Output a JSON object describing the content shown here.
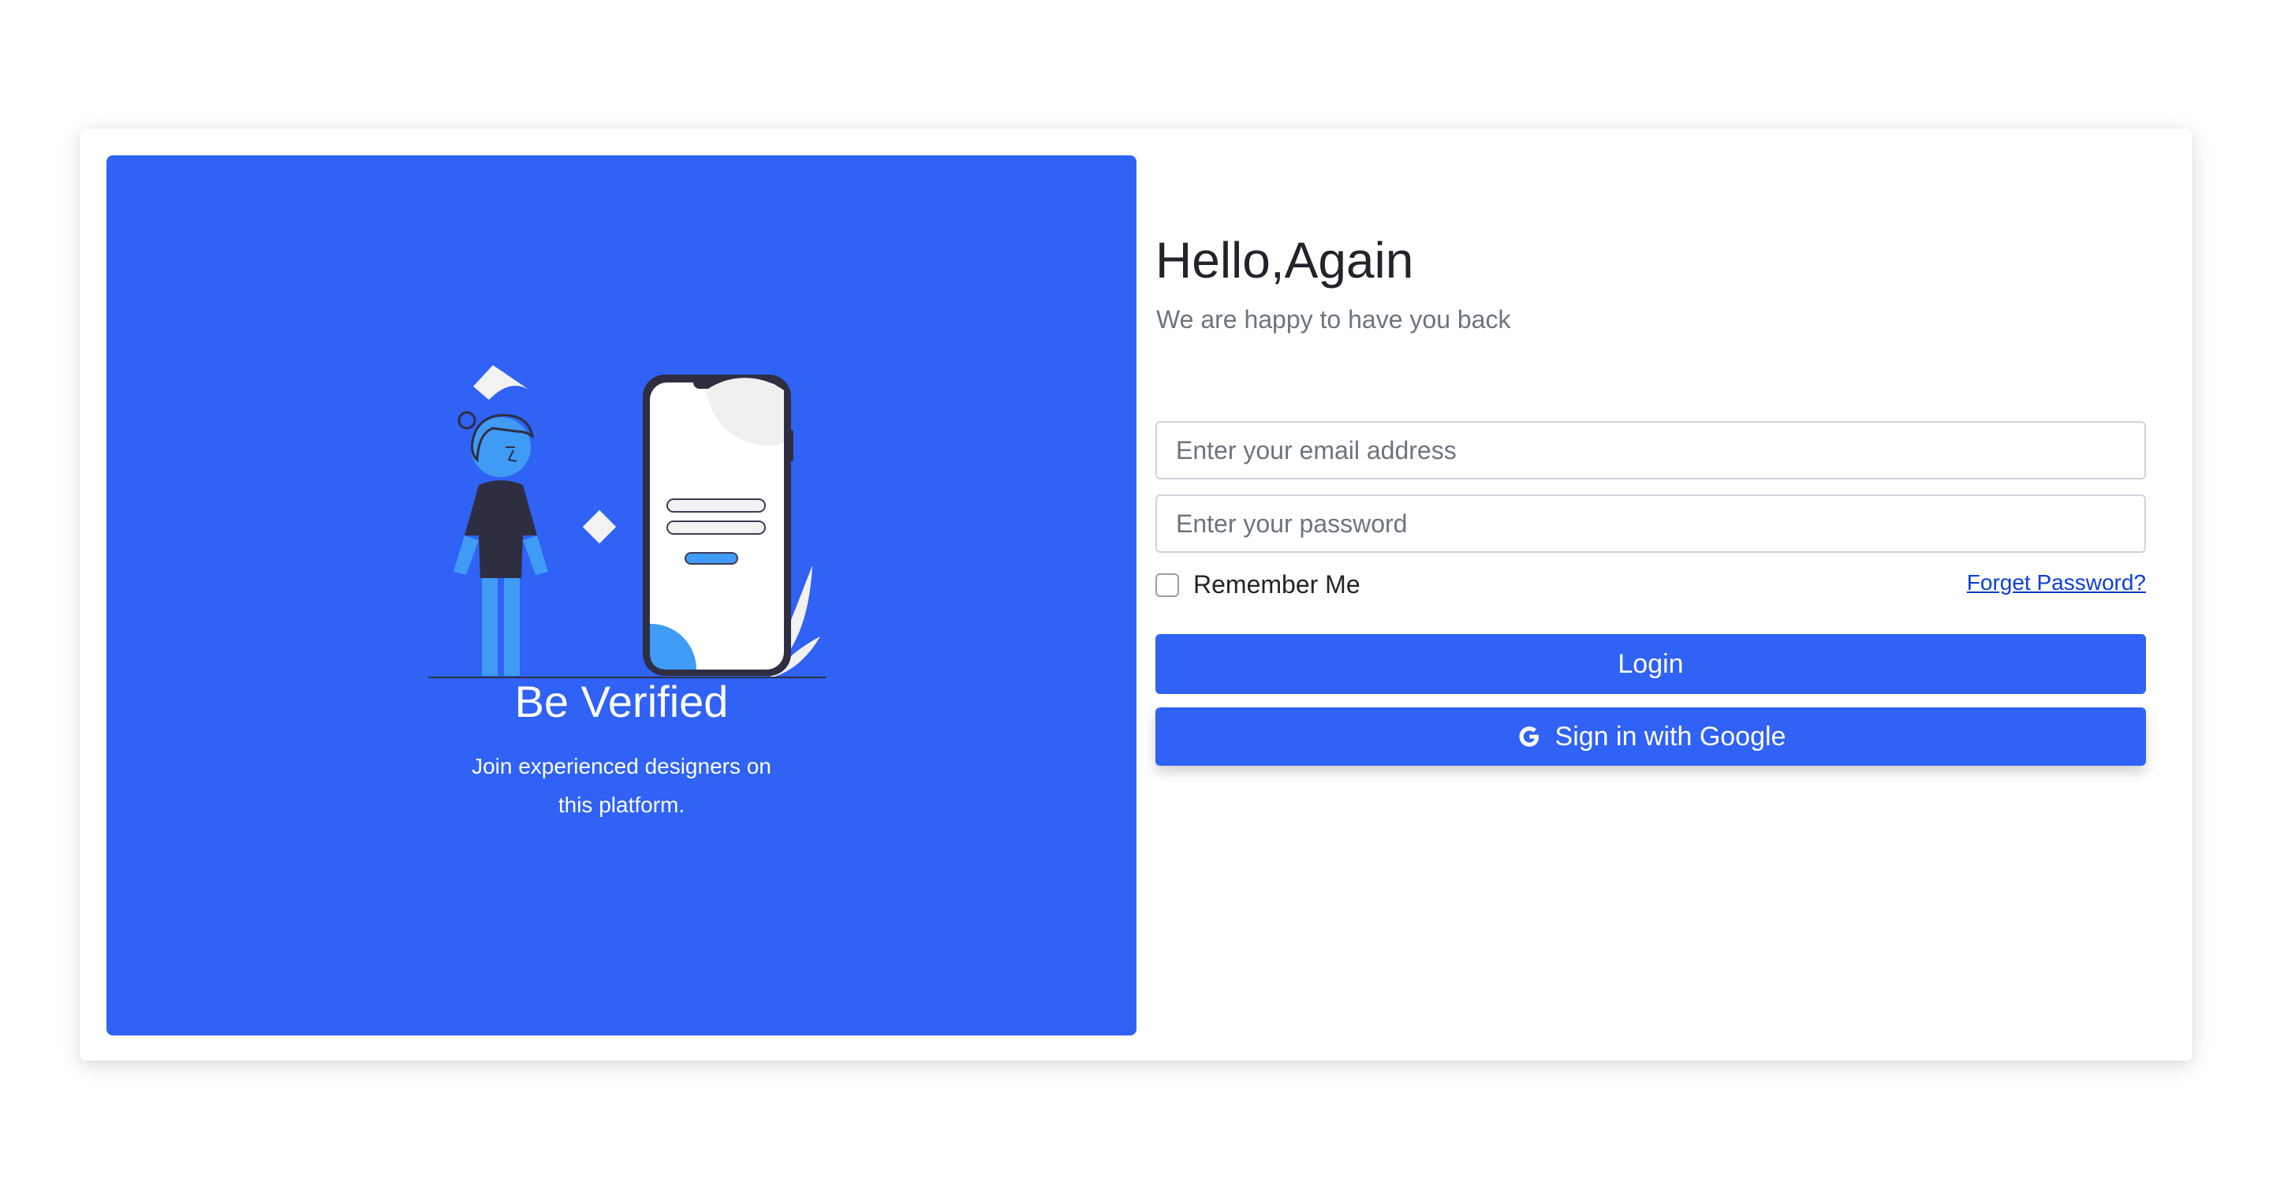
{
  "left_panel": {
    "heading": "Be Verified",
    "description": "Join experienced designers on this platform.",
    "background_color": "#2f62f5",
    "illustration": "person-with-phone-verification-illustration"
  },
  "login_form": {
    "title": "Hello,Again",
    "subtitle": "We are happy to have you back",
    "email": {
      "placeholder": "Enter your email address",
      "value": ""
    },
    "password": {
      "placeholder": "Enter your password",
      "value": ""
    },
    "remember_me": {
      "label": "Remember Me",
      "checked": false
    },
    "forget_password_label": "Forget Password?",
    "login_label": "Login",
    "google_label": "Sign in with Google",
    "google_icon": "google-g-icon",
    "accent_color": "#2f62f5"
  }
}
